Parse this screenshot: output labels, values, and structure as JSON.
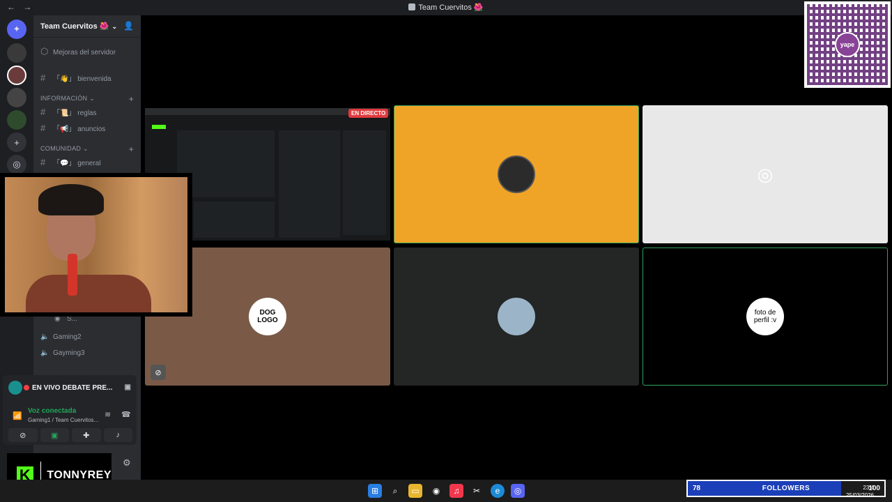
{
  "window": {
    "title": "Team Cuervitos 🌺",
    "back": "←",
    "forward": "→"
  },
  "server": {
    "name": "Team Cuervitos 🌺",
    "boost_label": "Mejoras del servidor",
    "channels_top": [
      {
        "name": "bienvenida",
        "emoji": "「👋」"
      }
    ],
    "categories": [
      {
        "name": "INFORMACIÓN",
        "channels": [
          {
            "name": "reglas",
            "emoji": "「📜」"
          },
          {
            "name": "anuncios",
            "emoji": "「📢」"
          }
        ]
      },
      {
        "name": "COMUNIDAD",
        "channels": [
          {
            "name": "general",
            "emoji": "「💬」"
          }
        ]
      }
    ],
    "voice_channels": [
      "Gaming2",
      "Gayming3"
    ],
    "voice_member_initial": "S..."
  },
  "voice_panel": {
    "stream_title": "EN VIVO DEBATE PRE...",
    "status": "Voz conectada",
    "location": "Gaming1 / Team Cuervitos..."
  },
  "stream": {
    "live_badge": "EN DIRECTO",
    "tiles": [
      {
        "label": "",
        "bg": "#141516"
      },
      {
        "label": "",
        "bg": "#f0a427"
      },
      {
        "label": "DOG LOGO",
        "bg": "#e8e8e8"
      },
      {
        "label": "",
        "bg": "#7a5a47"
      },
      {
        "label": "foto de perfil :v",
        "bg": "#232624"
      }
    ]
  },
  "overlay": {
    "brand": "K",
    "streamer_name": "TONNYREY",
    "qr_label": "yape",
    "followers": {
      "current": "78",
      "label": "FOLLOWERS",
      "goal": "100",
      "progress": 0.78
    }
  },
  "clock": {
    "time": "23:4",
    "date": "25/03/2026"
  },
  "colors": {
    "discord": "#5865f2",
    "green": "#23a55a",
    "live": "#e03a3e",
    "kick": "#53fc18"
  }
}
